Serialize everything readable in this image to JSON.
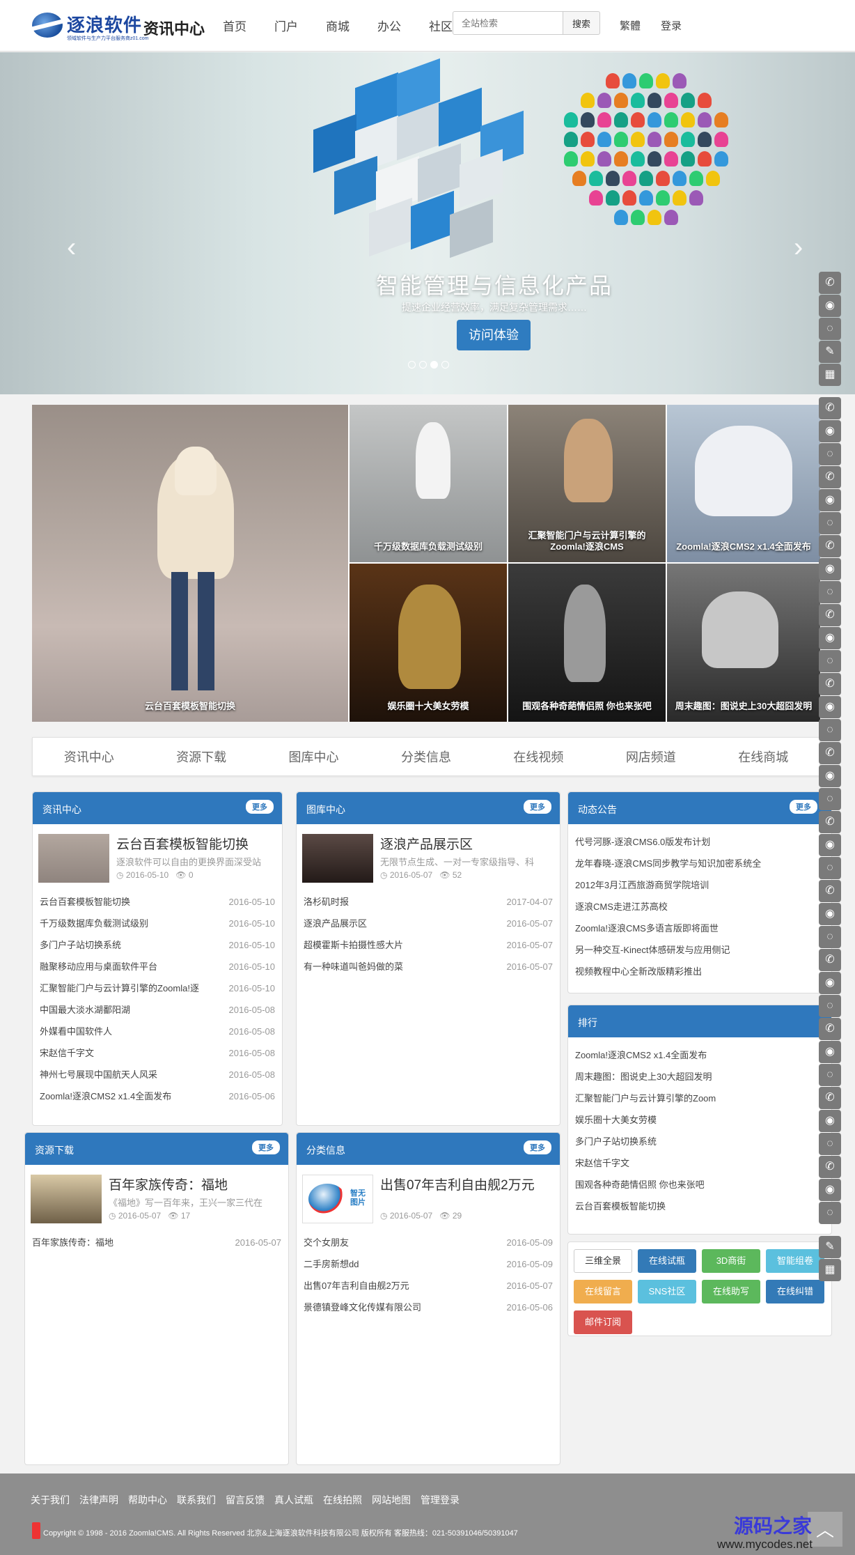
{
  "header": {
    "brand": "逐浪软件",
    "section": "资讯中心",
    "tagline": "领域软件与生产力平台服务商z01.com",
    "nav": [
      "首页",
      "门户",
      "商城",
      "办公",
      "社区"
    ],
    "search_placeholder": "全站检索",
    "search_button": "搜索",
    "lang": "繁體",
    "login": "登录"
  },
  "banner": {
    "title": "智能管理与信息化产品",
    "subtitle": "提速企业经营效率，满足复杂管理需求……",
    "button": "访问体验",
    "prev": "‹",
    "next": "›",
    "slide_count": 4,
    "active_slide": 3
  },
  "grid": {
    "big": "云台百套模板智能切换",
    "tiles": [
      "千万级数据库负载测试级别",
      "汇聚智能门户与云计算引擎的Zoomla!逐浪CMS",
      "Zoomla!逐浪CMS2 x1.4全面发布",
      "娱乐圈十大美女劳模",
      "围观各种奇葩情侣照 你也来张吧",
      "周末趣图：图说史上30大超囧发明"
    ]
  },
  "categories": [
    "资讯中心",
    "资源下载",
    "图库中心",
    "分类信息",
    "在线视频",
    "网店频道",
    "在线商城"
  ],
  "more_label": "更多",
  "news": {
    "title": "资讯中心",
    "feat": {
      "title": "云台百套模板智能切换",
      "desc": "逐浪软件可以自由的更换界面深受站",
      "date": "2016-05-10",
      "views": "0"
    },
    "rows": [
      {
        "name": "云台百套模板智能切换",
        "date": "2016-05-10"
      },
      {
        "name": "千万级数据库负载测试级别",
        "date": "2016-05-10"
      },
      {
        "name": "多门户子站切换系统",
        "date": "2016-05-10"
      },
      {
        "name": "融聚移动应用与桌面软件平台",
        "date": "2016-05-10"
      },
      {
        "name": "汇聚智能门户与云计算引擎的Zoomla!逐",
        "date": "2016-05-10"
      },
      {
        "name": "中国最大淡水湖鄱阳湖",
        "date": "2016-05-08"
      },
      {
        "name": "外媒看中国软件人",
        "date": "2016-05-08"
      },
      {
        "name": "宋赵信千字文",
        "date": "2016-05-08"
      },
      {
        "name": "神州七号展现中国航天人风采",
        "date": "2016-05-08"
      },
      {
        "name": "Zoomla!逐浪CMS2 x1.4全面发布",
        "date": "2016-05-06"
      }
    ]
  },
  "gallery": {
    "title": "图库中心",
    "feat": {
      "title": "逐浪产品展示区",
      "desc": "无限节点生成、一对一专家级指导、科",
      "date": "2016-05-07",
      "views": "52"
    },
    "rows": [
      {
        "name": "洛杉矶时报",
        "date": "2017-04-07"
      },
      {
        "name": "逐浪产品展示区",
        "date": "2016-05-07"
      },
      {
        "name": "超模霍斯卡拍摄性感大片",
        "date": "2016-05-07"
      },
      {
        "name": "有一种味道叫爸妈做的菜",
        "date": "2016-05-07"
      }
    ]
  },
  "notice": {
    "title": "动态公告",
    "rows": [
      "代号河豚-逐浪CMS6.0版发布计划",
      "龙年春晓-逐浪CMS同步教学与知识加密系统全",
      "2012年3月江西旅游商贸学院培训",
      "逐浪CMS走进江苏高校",
      "Zoomla!逐浪CMS多语言版即将面世",
      "另一种交互-Kinect体感研发与应用侧记",
      "视频教程中心全新改版精彩推出"
    ]
  },
  "rank": {
    "title": "排行",
    "rows": [
      "Zoomla!逐浪CMS2 x1.4全面发布",
      "周末趣图：图说史上30大超囧发明",
      "汇聚智能门户与云计算引擎的Zoom",
      "娱乐圈十大美女劳模",
      "多门户子站切换系统",
      "宋赵信千字文",
      "围观各种奇葩情侣照 你也来张吧",
      "云台百套模板智能切换"
    ]
  },
  "quick": [
    {
      "label": "三维全景",
      "color": "#ffffff"
    },
    {
      "label": "在线试瓶",
      "color": "#337ab7"
    },
    {
      "label": "3D商街",
      "color": "#5cb85c"
    },
    {
      "label": "智能组卷",
      "color": "#5bc0de"
    },
    {
      "label": "在线留言",
      "color": "#f0ad4e"
    },
    {
      "label": "SNS社区",
      "color": "#5bc0de"
    },
    {
      "label": "在线助写",
      "color": "#5cb85c"
    },
    {
      "label": "在线纠错",
      "color": "#337ab7"
    },
    {
      "label": "邮件订阅",
      "color": "#d9534f"
    }
  ],
  "download": {
    "title": "资源下载",
    "feat": {
      "title": "百年家族传奇：福地",
      "desc": "《福地》写一百年来，王兴一家三代在",
      "date": "2016-05-07",
      "views": "17"
    },
    "rows": [
      {
        "name": "百年家族传奇：福地",
        "date": "2016-05-07"
      }
    ]
  },
  "classified": {
    "title": "分类信息",
    "feat": {
      "title": "出售07年吉利自由舰2万元",
      "desc": "",
      "date": "2016-05-07",
      "views": "29",
      "thumb_text": "智无图片"
    },
    "rows": [
      {
        "name": "交个女朋友",
        "date": "2016-05-09"
      },
      {
        "name": "二手房新想dd",
        "date": "2016-05-09"
      },
      {
        "name": "出售07年吉利自由舰2万元",
        "date": "2016-05-07"
      },
      {
        "name": "景德镇登峰文化传媒有限公司",
        "date": "2016-05-06"
      }
    ]
  },
  "footer": {
    "links": [
      "关于我们",
      "法律声明",
      "帮助中心",
      "联系我们",
      "留言反馈",
      "真人试瓶",
      "在线拍照",
      "网站地图",
      "管理登录"
    ],
    "copyright": "Copyright © 1998 - 2016 Zoomla!CMS. All Rights Reserved 北京&上海逐浪软件科技有限公司 版权所有 客服热线：021-50391046/50391047",
    "watermark": "源码之家",
    "watermark_url": "www.mycodes.net",
    "totop": "︿"
  }
}
